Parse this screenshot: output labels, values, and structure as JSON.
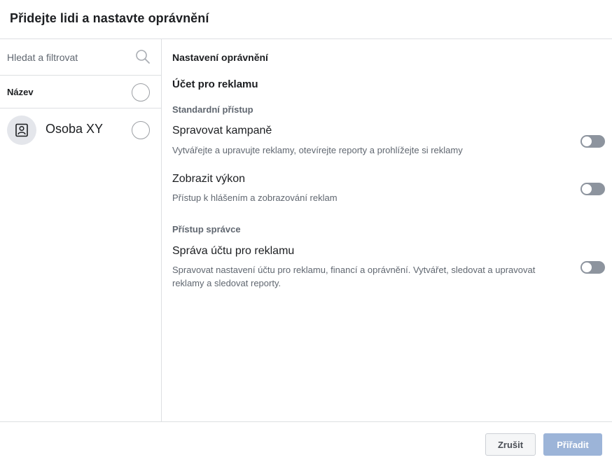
{
  "dialog": {
    "title": "Přidejte lidi a nastavte oprávnění"
  },
  "left": {
    "search": {
      "placeholder": "Hledat a filtrovat",
      "value": "",
      "icon": "search-icon"
    },
    "name_header": "Název",
    "people": [
      {
        "name": "Osoba XY",
        "icon": "person-badge-icon",
        "selected": false
      }
    ]
  },
  "right": {
    "permissions_title": "Nastavení oprávnění",
    "account_title": "Účet pro reklamu",
    "sections": [
      {
        "label": "Standardní přístup",
        "items": [
          {
            "name": "Spravovat kampaně",
            "description": "Vytvářejte a upravujte reklamy, otevírejte reporty a prohlížejte si reklamy",
            "enabled": false
          },
          {
            "name": "Zobrazit výkon",
            "description": "Přístup k hlášením a zobrazování reklam",
            "enabled": false
          }
        ]
      },
      {
        "label": "Přístup správce",
        "items": [
          {
            "name": "Správa účtu pro reklamu",
            "description": "Spravovat nastavení účtu pro reklamu, financí a oprávnění. Vytvářet, sledovat a upravovat reklamy a sledovat reporty.",
            "enabled": false
          }
        ]
      }
    ]
  },
  "footer": {
    "cancel_label": "Zrušit",
    "assign_label": "Přiřadit"
  },
  "colors": {
    "toggle_off": "#8d949e",
    "assign_disabled": "#9cb4d8",
    "border": "#dddfe2",
    "secondary_text": "#606770"
  }
}
